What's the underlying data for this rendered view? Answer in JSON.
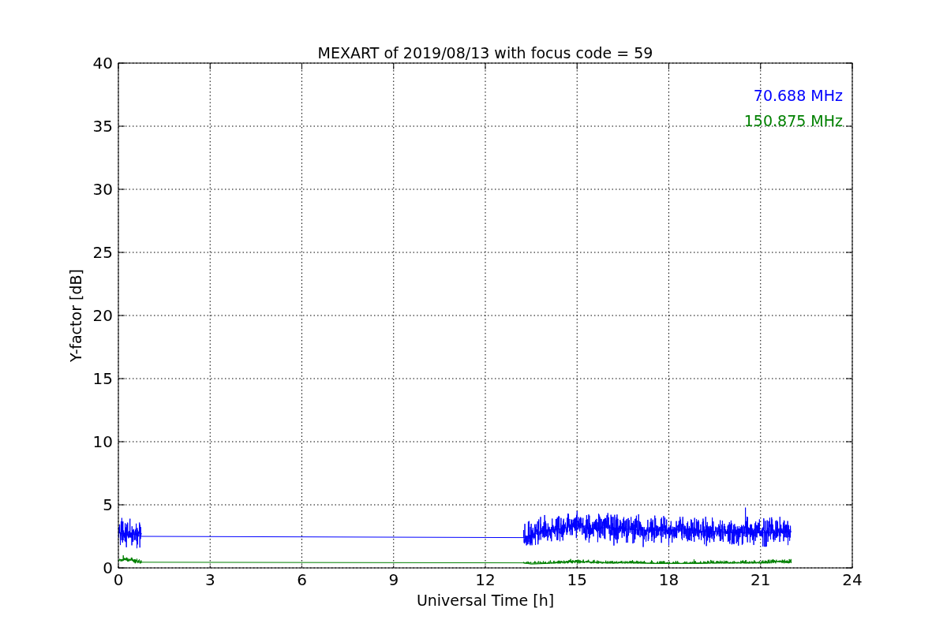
{
  "chart_data": {
    "type": "line",
    "title": "MEXART of 2019/08/13 with focus code = 59",
    "xlabel": "Universal Time [h]",
    "ylabel": "Y-factor [dB]",
    "x": [
      0,
      0.25,
      0.5,
      0.75,
      13.25,
      13.5,
      14,
      14.5,
      15,
      15.5,
      16,
      16.5,
      17,
      17.5,
      18,
      18.5,
      19,
      19.5,
      20,
      20.5,
      21,
      21.5,
      22
    ],
    "series": [
      {
        "name": "70.688 MHz",
        "color": "#0000ff",
        "values": [
          2.8,
          2.6,
          2.7,
          2.5,
          2.4,
          2.6,
          3.0,
          3.1,
          3.4,
          3.1,
          3.2,
          3.1,
          3.0,
          3.0,
          3.0,
          3.1,
          2.9,
          2.9,
          2.8,
          2.8,
          2.8,
          2.8,
          2.9
        ]
      },
      {
        "name": "150.875 MHz",
        "color": "#008000",
        "values": [
          0.6,
          0.7,
          0.6,
          0.45,
          0.4,
          0.3,
          0.35,
          0.45,
          0.5,
          0.45,
          0.4,
          0.4,
          0.4,
          0.35,
          0.35,
          0.35,
          0.35,
          0.4,
          0.4,
          0.4,
          0.4,
          0.5,
          0.5
        ]
      }
    ],
    "grid": true,
    "xlim": [
      0,
      24
    ],
    "ylim": [
      0,
      40
    ],
    "xticks": [
      0,
      3,
      6,
      9,
      12,
      15,
      18,
      21,
      24
    ],
    "yticks": [
      0,
      5,
      10,
      15,
      20,
      25,
      30,
      35,
      40
    ]
  }
}
